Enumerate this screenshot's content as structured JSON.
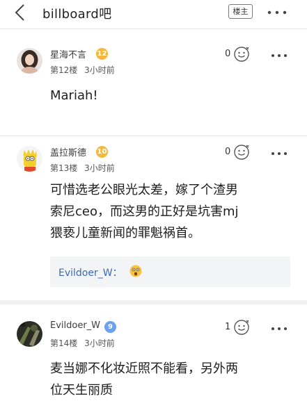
{
  "topbar": {
    "title": "billboard吧",
    "louzhu_label": "楼主"
  },
  "posts": [
    {
      "username": "星海不言",
      "level": "12",
      "floor": "第12楼",
      "time": "3小时前",
      "likes": "0",
      "content_lines": [
        "Mariah!"
      ]
    },
    {
      "username": "盖拉斯德",
      "level": "10",
      "floor": "第13楼",
      "time": "3小时前",
      "likes": "0",
      "content_lines": [
        "可惜选老公眼光太差，嫁了个渣男",
        "索尼ceo，而这男的正好是坑害mj",
        "猥亵儿童新闻的罪魁祸首。"
      ],
      "reply": {
        "name": "Evildoer_W："
      }
    },
    {
      "username": "Evildoer_W",
      "level": "9",
      "floor": "第14楼",
      "time": "3小时前",
      "likes": "1",
      "content_lines": [
        "麦当娜不化妆近照不能看，另外两",
        "位天生丽质"
      ]
    }
  ],
  "colors": {
    "level_gold": "#f5b83a",
    "level_blue": "#6aa1f0",
    "reply_name": "#3a6ab8"
  }
}
